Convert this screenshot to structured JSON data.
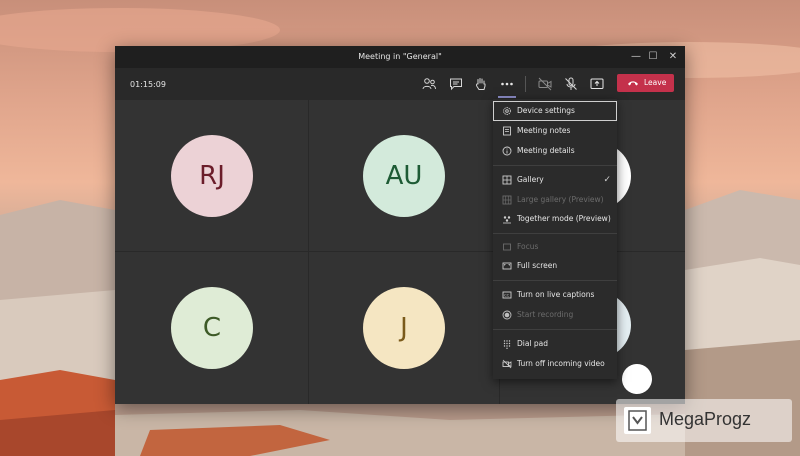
{
  "window": {
    "title": "Meeting in \"General\""
  },
  "toolbar": {
    "timer": "01:15:09",
    "leave_label": "Leave",
    "icons": [
      "participants-icon",
      "chat-icon",
      "raise-hand-icon",
      "more-actions-icon",
      "camera-off-icon",
      "mic-off-icon",
      "share-screen-icon"
    ]
  },
  "participants": [
    {
      "initials": "RJ",
      "bg": "#ecd2d6",
      "fg": "#6b1d2a"
    },
    {
      "initials": "AU",
      "bg": "#d3eadb",
      "fg": "#1e5b35"
    },
    {
      "initials": "C",
      "bg": "#dfecd6",
      "fg": "#3d5a27"
    },
    {
      "initials": "J",
      "bg": "#f5e6c2",
      "fg": "#7a5a1a"
    }
  ],
  "menu": {
    "items": [
      {
        "label": "Device settings",
        "icon": "gear-icon",
        "enabled": true,
        "selected": true
      },
      {
        "label": "Meeting notes",
        "icon": "notes-icon",
        "enabled": true
      },
      {
        "label": "Meeting details",
        "icon": "info-icon",
        "enabled": true
      },
      {
        "label": "Gallery",
        "icon": "gallery-icon",
        "enabled": true,
        "checked": true
      },
      {
        "label": "Large gallery (Preview)",
        "icon": "large-gallery-icon",
        "enabled": false
      },
      {
        "label": "Together mode (Preview)",
        "icon": "together-mode-icon",
        "enabled": true
      },
      {
        "label": "Focus",
        "icon": "focus-icon",
        "enabled": false
      },
      {
        "label": "Full screen",
        "icon": "fullscreen-icon",
        "enabled": true
      },
      {
        "label": "Turn on live captions",
        "icon": "captions-icon",
        "enabled": true
      },
      {
        "label": "Start recording",
        "icon": "record-icon",
        "enabled": false
      },
      {
        "label": "Dial pad",
        "icon": "dialpad-icon",
        "enabled": true
      },
      {
        "label": "Turn off incoming video",
        "icon": "video-off-icon",
        "enabled": true
      }
    ],
    "check_glyph": "✓"
  },
  "watermark": {
    "text": "MegaProgz"
  },
  "colors": {
    "leave": "#c4314b",
    "accent": "#8b8cc7",
    "window_bg": "#292929"
  }
}
